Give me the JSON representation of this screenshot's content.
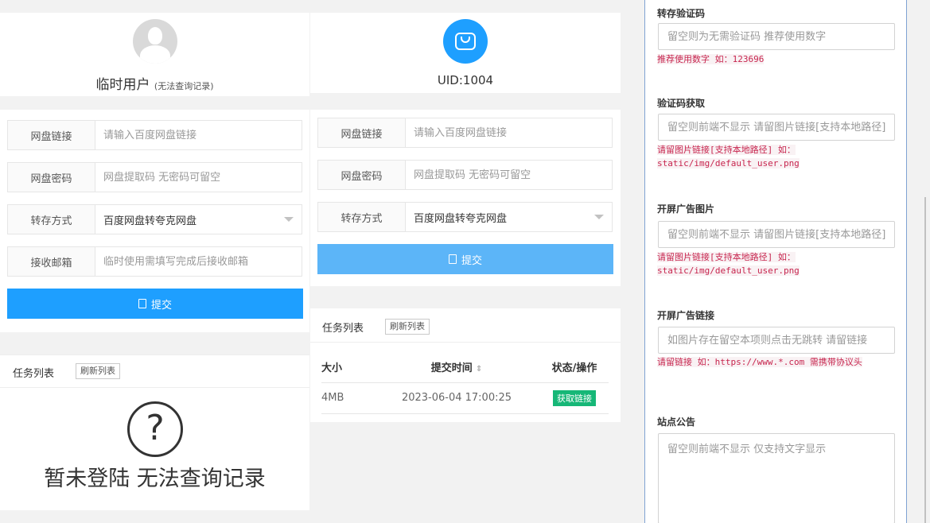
{
  "left_panel": {
    "user_name": "临时用户",
    "user_note": "(无法查询记录)",
    "form": {
      "link_label": "网盘链接",
      "link_placeholder": "请输入百度网盘链接",
      "pwd_label": "网盘密码",
      "pwd_placeholder": "网盘提取码 无密码可留空",
      "mode_label": "转存方式",
      "mode_value": "百度网盘转夸克网盘",
      "email_label": "接收邮箱",
      "email_placeholder": "临时使用需填写完成后接收邮箱",
      "submit_label": "提交"
    },
    "task_list_label": "任务列表",
    "refresh_label": "刷新列表",
    "empty_text": "暂未登陆 无法查询记录"
  },
  "middle_panel": {
    "uid": "UID:1004",
    "form": {
      "link_label": "网盘链接",
      "link_placeholder": "请输入百度网盘链接",
      "pwd_label": "网盘密码",
      "pwd_placeholder": "网盘提取码 无密码可留空",
      "mode_label": "转存方式",
      "mode_value": "百度网盘转夸克网盘",
      "submit_label": "提交"
    },
    "task_list_label": "任务列表",
    "refresh_label": "刷新列表",
    "table": {
      "headers": [
        "大小",
        "提交时间",
        "状态/操作"
      ],
      "rows": [
        {
          "size": "4MB",
          "time": "2023-06-04 17:00:25",
          "action": "获取链接"
        }
      ]
    }
  },
  "settings": {
    "verify_code": {
      "label": "转存验证码",
      "placeholder": "留空则为无需验证码 推荐使用数字",
      "hint": "推荐使用数字 如：123696"
    },
    "verify_fetch": {
      "label": "验证码获取",
      "placeholder": "留空则前端不显示 请留图片链接[支持本地路径]",
      "hint": "请留图片链接[支持本地路径] 如：static/img/default_user.png"
    },
    "splash_image": {
      "label": "开屏广告图片",
      "placeholder": "留空则前端不显示 请留图片链接[支持本地路径]",
      "hint": "请留图片链接[支持本地路径] 如：static/img/default_user.png"
    },
    "splash_link": {
      "label": "开屏广告链接",
      "placeholder": "如图片存在留空本项则点击无跳转 请留链接",
      "hint": "请留链接 如：https://www.*.com 需携带协议头"
    },
    "notice": {
      "label": "站点公告",
      "placeholder": "留空则前端不显示 仅支持文字显示"
    }
  },
  "colors": {
    "primary": "#1e9fff",
    "success": "#16b777",
    "hint": "#c7254e"
  }
}
